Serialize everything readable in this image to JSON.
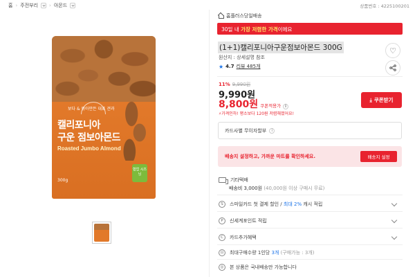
{
  "breadcrumb": {
    "items": [
      "홈",
      "주전부리",
      "아몬드"
    ]
  },
  "product_no": "상품번호 : 4225100201",
  "image": {
    "tag": "보다 & 볶아만든 대표 견과",
    "line1": "캘리포니아",
    "line2": "구운 점보아몬드",
    "line3": "Roasted Jumbo Almond",
    "badge": "협업 시즈닝",
    "weight": "300g"
  },
  "delivery_label": "홈플러스당일배송",
  "promo": {
    "prefix": "30일 내 ",
    "highlight": "가장 저렴한 가격",
    "suffix": "이에요"
  },
  "title": "(1+1)캘리포니아구운점보아몬드 300G",
  "origin": "원산지 : 상세설명 참조",
  "rating": {
    "score": "4.7",
    "reviews": "리뷰 485개"
  },
  "price": {
    "discount_pct": "11%",
    "original": "9,990원",
    "current": "9,990원",
    "coupon_price": "8,800원",
    "coupon_label": "쿠폰적용가",
    "note": "⚡가격인하! 평소보다 120원 저렴해졌어요!"
  },
  "coupon_button": "쿠폰받기",
  "card_discount": "카드사별 무이자할부",
  "address_banner": {
    "text": "배송지 설정하고, 가까운 마트를 확인하세요.",
    "button": "배송지 설정"
  },
  "shipping": {
    "title": "기타택배",
    "fee": "배송비 3,000원",
    "fee_note": "(40,000원 이상 구매시 무료)"
  },
  "benefits": [
    {
      "icon": "S",
      "text_a": "스마일카드 첫 결제 할인 / ",
      "text_b": "최대 2%",
      "text_c": " 캐시 적립"
    },
    {
      "icon": "P",
      "text": "신세계포인트 적립"
    },
    {
      "icon": "C",
      "text": "카드추가혜택"
    }
  ],
  "purchase_limit": {
    "a": "최대구매수량 1인당 ",
    "b": "3개",
    "c": " (구매가능 : 3개)"
  },
  "domestic_note": "본 상품은 국내배송만 가능합니다",
  "colors": {
    "accent": "#e8232f",
    "blue": "#1a73e8"
  }
}
